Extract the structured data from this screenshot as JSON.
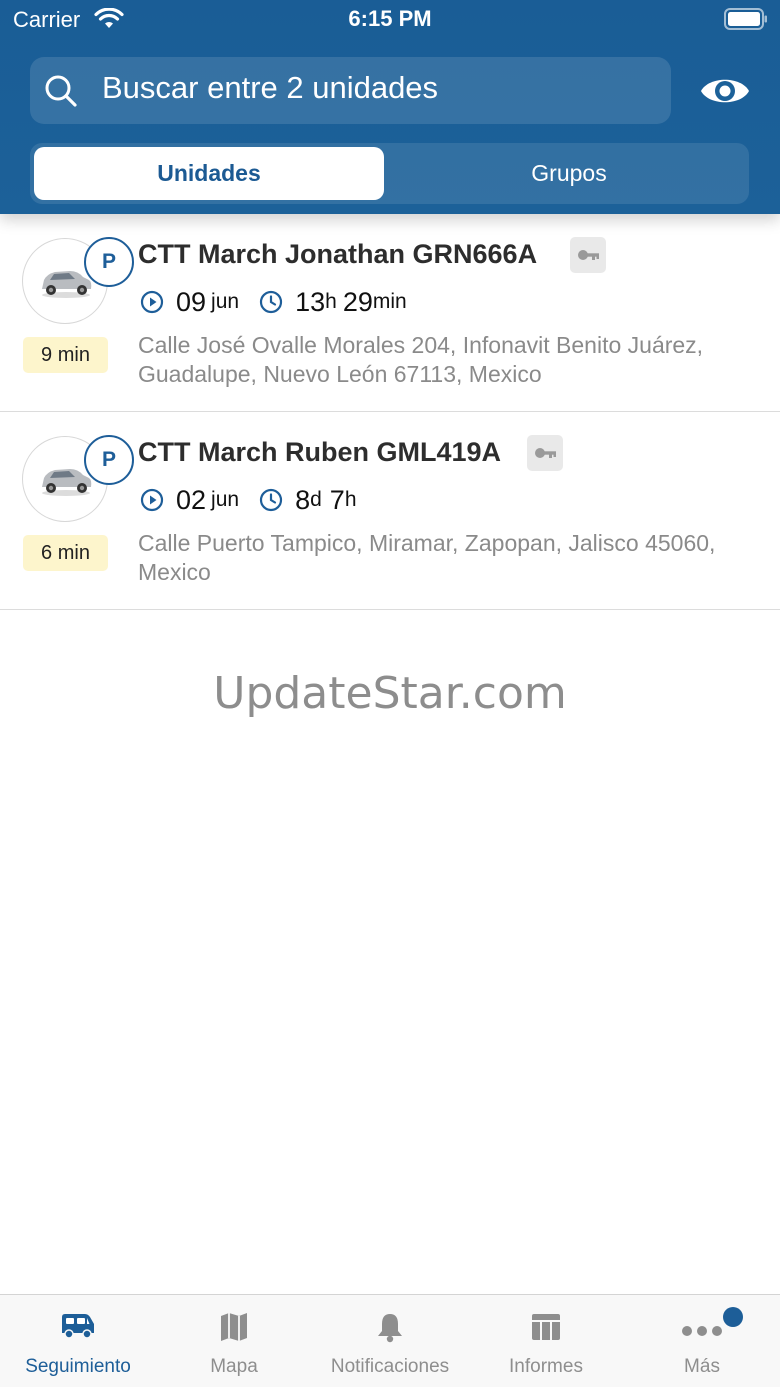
{
  "status_bar": {
    "carrier": "Carrier",
    "time": "6:15 PM"
  },
  "search": {
    "placeholder": "Buscar entre 2 unidades"
  },
  "segments": {
    "active": "Unidades",
    "inactive": "Grupos"
  },
  "units": [
    {
      "name": "CTT March Jonathan GRN666A",
      "date_day": "09",
      "date_month": "jun",
      "duration_a": "13",
      "duration_a_unit": "h",
      "duration_b": "29",
      "duration_b_unit": "min",
      "ago": "9 min",
      "address": "Calle José Ovalle Morales 204, Infonavit Benito Juárez, Guadalupe, Nuevo León 67113, Mexico",
      "status_letter": "P"
    },
    {
      "name": "CTT March Ruben GML419A",
      "date_day": "02",
      "date_month": "jun",
      "duration_a": "8",
      "duration_a_unit": "d",
      "duration_b": "7",
      "duration_b_unit": "h",
      "ago": "6 min",
      "address": "Calle Puerto Tampico, Miramar, Zapopan, Jalisco 45060, Mexico",
      "status_letter": "P"
    }
  ],
  "watermark": "UpdateStar.com",
  "tabs": [
    {
      "label": "Seguimiento",
      "icon": "van-icon",
      "active": true
    },
    {
      "label": "Mapa",
      "icon": "map-icon"
    },
    {
      "label": "Notificaciones",
      "icon": "bell-icon"
    },
    {
      "label": "Informes",
      "icon": "table-icon"
    },
    {
      "label": "Más",
      "icon": "more-icon"
    }
  ],
  "colors": {
    "header": "#1c6199",
    "accent": "#1d5e98",
    "ago_badge": "#fdf5cc"
  }
}
